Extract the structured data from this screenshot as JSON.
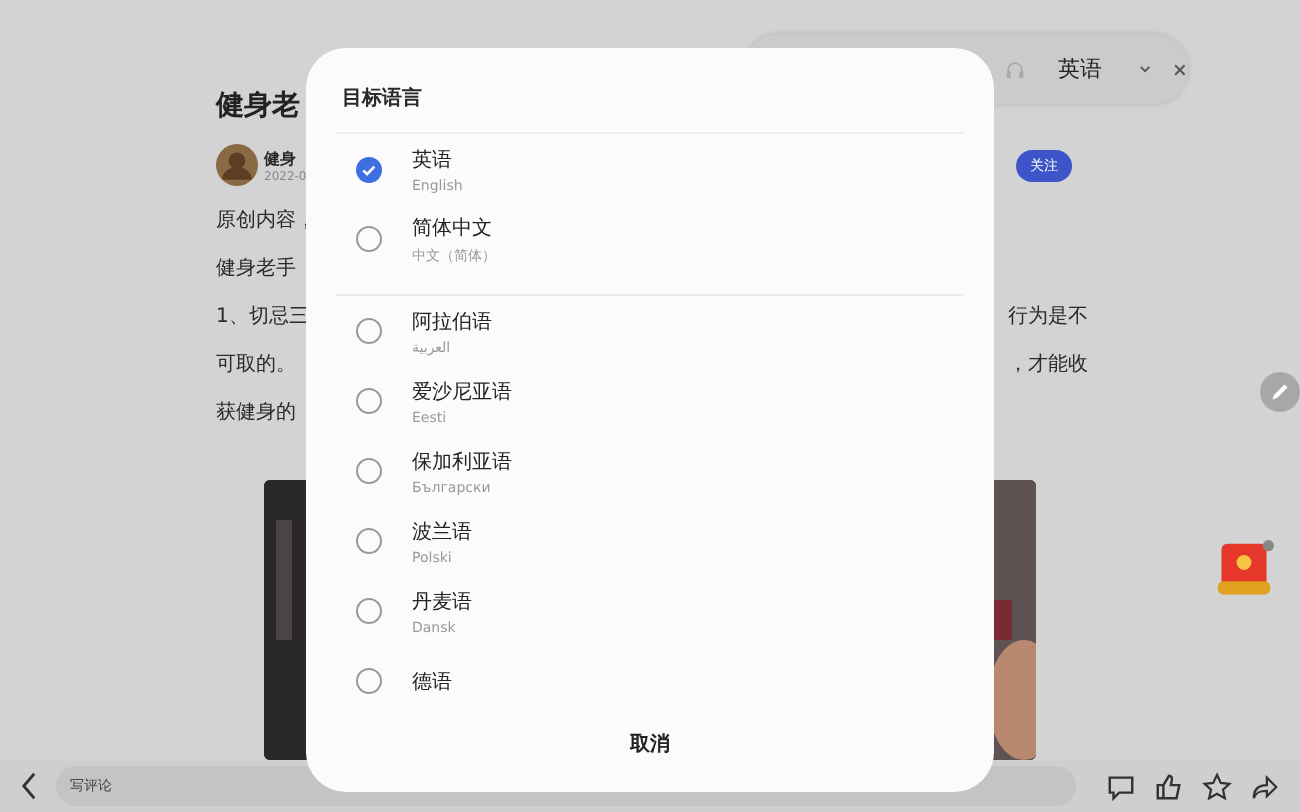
{
  "translate_bar": {
    "language": "英语"
  },
  "article": {
    "title": "健身老",
    "author": "健身",
    "date": "2022-0",
    "follow_button": "关注",
    "lines": [
      {
        "left": "原创内容，"
      },
      {
        "left": "健身老手"
      },
      {
        "left": "1、切忌三",
        "right": "行为是不"
      },
      {
        "left": "可取的。",
        "right": "，才能收"
      },
      {
        "left": "获健身的"
      }
    ]
  },
  "dialog": {
    "title": "目标语言",
    "languages": [
      {
        "name": "英语",
        "native": "English",
        "selected": true
      },
      {
        "name": "简体中文",
        "native": "中文（简体）",
        "selected": false
      },
      {
        "name": "阿拉伯语",
        "native": "العربية",
        "selected": false
      },
      {
        "name": "爱沙尼亚语",
        "native": "Eesti",
        "selected": false
      },
      {
        "name": "保加利亚语",
        "native": "Български",
        "selected": false
      },
      {
        "name": "波兰语",
        "native": "Polski",
        "selected": false
      },
      {
        "name": "丹麦语",
        "native": "Dansk",
        "selected": false
      },
      {
        "name": "德语",
        "selected": false
      }
    ],
    "cancel_button": "取消"
  },
  "comment_bar": {
    "placeholder": "写评论"
  }
}
